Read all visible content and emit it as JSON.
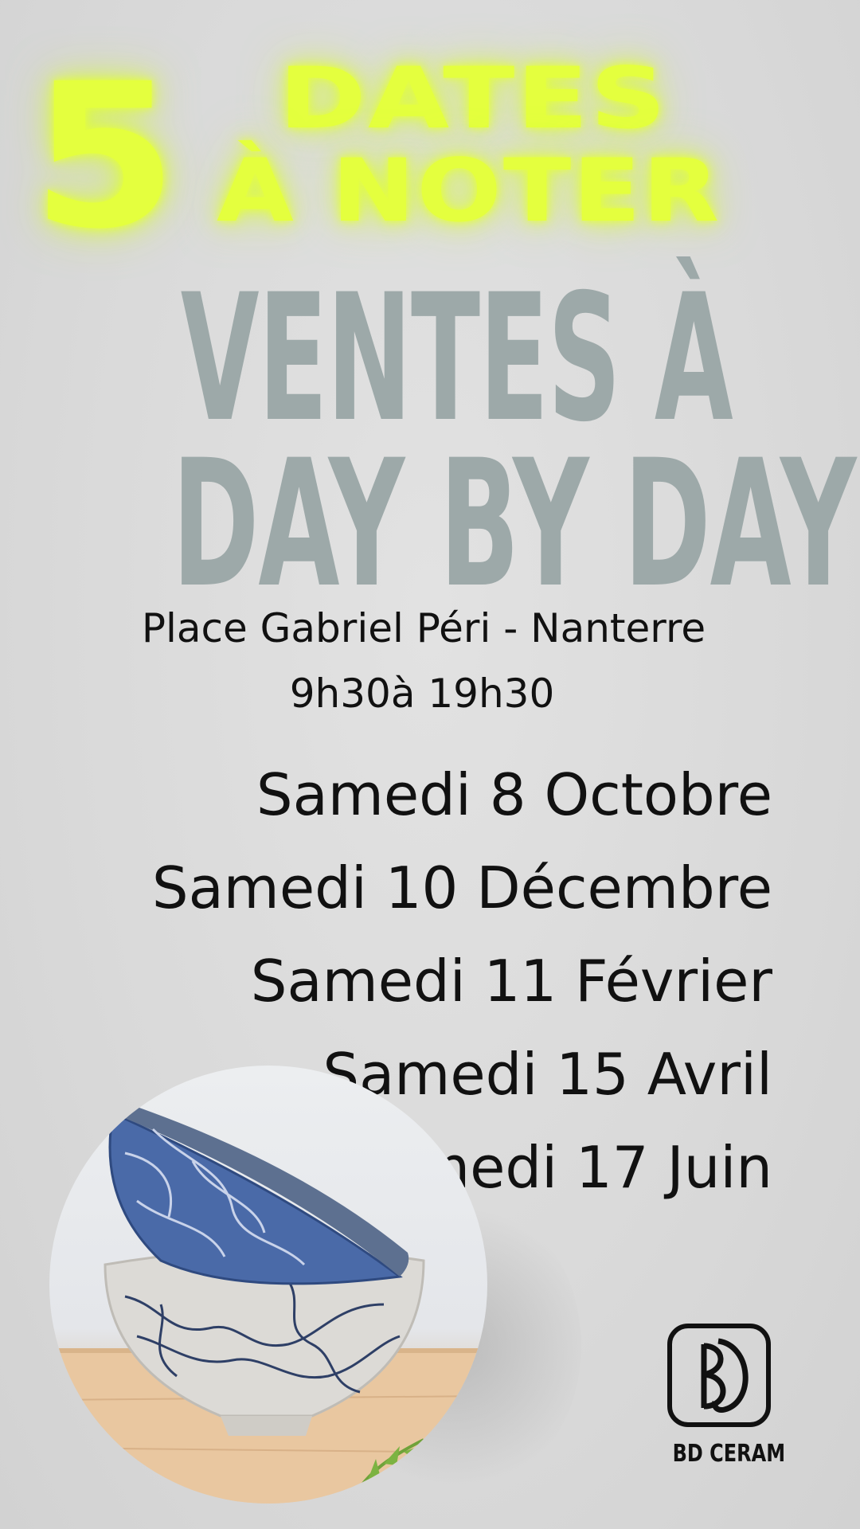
{
  "header": {
    "number": "5",
    "line1": "DATES",
    "line2": "À NOTER",
    "neon_color": "#e4ff3e"
  },
  "headline": {
    "line1": "VENTES À",
    "line2": "DAY BY DAY",
    "color": "#9da9a9"
  },
  "venue": {
    "place": "Place Gabriel Péri - Nanterre",
    "hours": "9h30à 19h30"
  },
  "dates": [
    "Samedi 8 Octobre",
    "Samedi 10 Décembre",
    "Samedi 11 Février",
    "Samedi 15 Avril",
    "Samedi 17 Juin"
  ],
  "image": {
    "icon": "ceramic-bowls-photo"
  },
  "brand": {
    "name": "BD CERAM",
    "icon": "bd-ceram-logo-icon"
  }
}
